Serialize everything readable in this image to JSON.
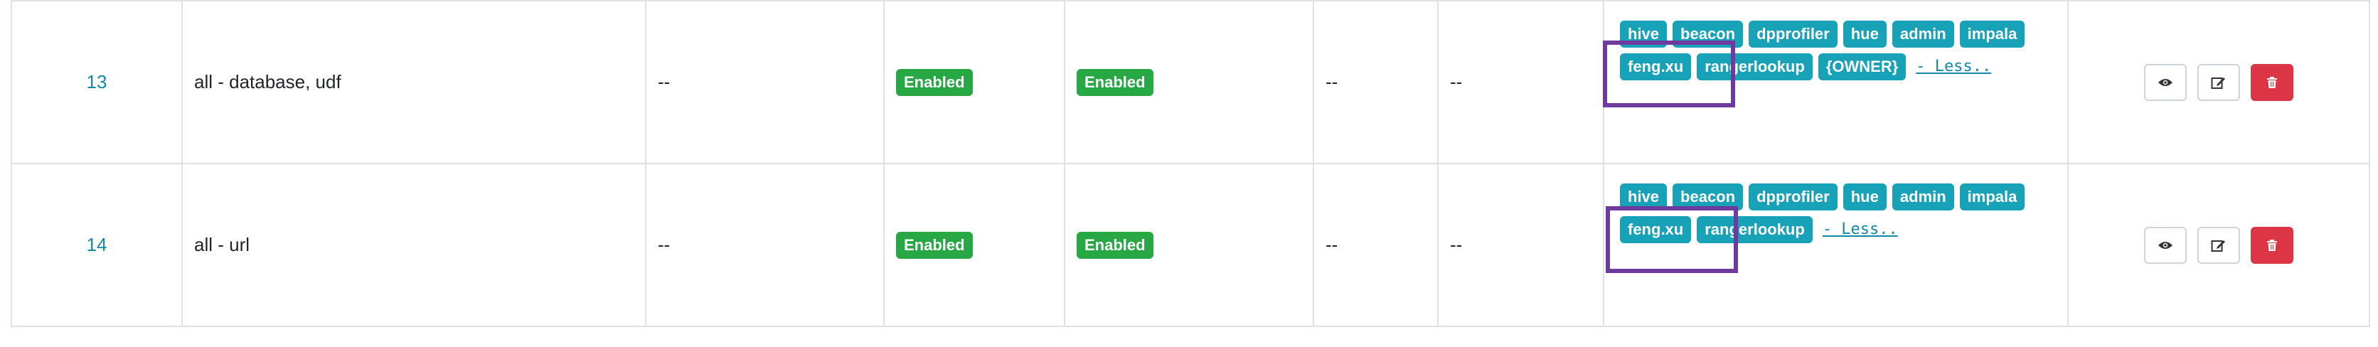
{
  "rows": [
    {
      "id": "13",
      "name": "all - database, udf",
      "labels": "--",
      "status": "Enabled",
      "audit": "Enabled",
      "roles": "--",
      "groups": "--",
      "users": [
        "hive",
        "beacon",
        "dpprofiler",
        "hue",
        "admin",
        "impala",
        "feng.xu",
        "rangerlookup",
        "{OWNER}"
      ],
      "less_label": "- Less..",
      "highlighted_user": "feng.xu"
    },
    {
      "id": "14",
      "name": "all - url",
      "labels": "--",
      "status": "Enabled",
      "audit": "Enabled",
      "roles": "--",
      "groups": "--",
      "users": [
        "hive",
        "beacon",
        "dpprofiler",
        "hue",
        "admin",
        "impala",
        "feng.xu",
        "rangerlookup"
      ],
      "less_label": "- Less..",
      "highlighted_user": "feng.xu"
    }
  ],
  "actions": [
    {
      "name": "view",
      "icon": "eye-icon"
    },
    {
      "name": "edit",
      "icon": "edit-icon"
    },
    {
      "name": "delete",
      "icon": "trash-icon"
    }
  ],
  "colors": {
    "badge_enabled": "#28a745",
    "user_tag": "#17a2b8",
    "link": "#1488a8",
    "delete": "#dc3545",
    "highlight": "#6f3a9e"
  }
}
